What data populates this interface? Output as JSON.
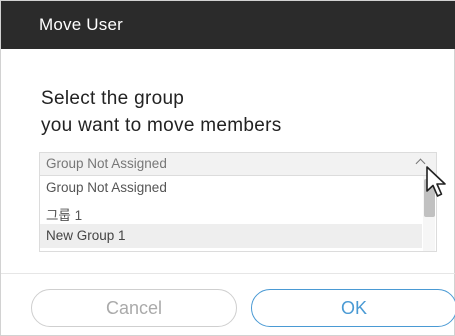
{
  "dialog": {
    "title": "Move User",
    "prompt_lines": [
      "Select the group",
      "you want to move members"
    ],
    "select": {
      "selected_value": "Group Not Assigned",
      "options": [
        "Group Not Assigned",
        "그룹 1",
        "New Group 1"
      ],
      "highlighted_option": "New Group 1"
    },
    "buttons": {
      "cancel_label": "Cancel",
      "ok_label": "OK"
    }
  },
  "colors": {
    "titlebar": "#2b2b2b",
    "ok_accent": "#4a9ad4",
    "cancel_text": "#aaaaaa"
  },
  "icons": {
    "select_toggle": "chevron-up-icon",
    "pointer": "mouse-cursor-icon"
  }
}
